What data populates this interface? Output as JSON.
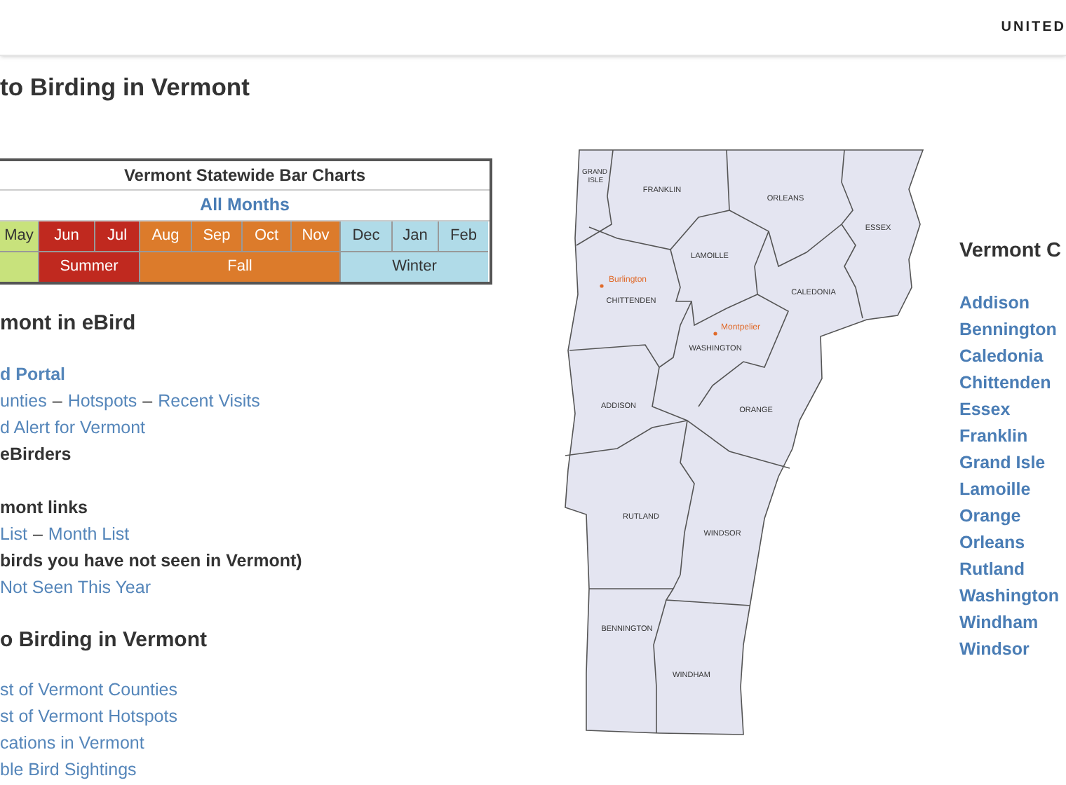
{
  "header": {
    "text": "UNITED"
  },
  "title": "to Birding in Vermont",
  "bar_chart_table": {
    "title": "Vermont Statewide Bar Charts",
    "all_months": "All Months",
    "months": [
      {
        "label": "May",
        "kind": "spring"
      },
      {
        "label": "Jun",
        "kind": "summer"
      },
      {
        "label": "Jul",
        "kind": "summer"
      },
      {
        "label": "Aug",
        "kind": "fall"
      },
      {
        "label": "Sep",
        "kind": "fall"
      },
      {
        "label": "Oct",
        "kind": "fall"
      },
      {
        "label": "Nov",
        "kind": "fall"
      },
      {
        "label": "Dec",
        "kind": "winter"
      },
      {
        "label": "Jan",
        "kind": "winter"
      },
      {
        "label": "Feb",
        "kind": "winter"
      }
    ],
    "seasons": [
      {
        "kind": "spring"
      },
      {
        "label": "Summer",
        "kind": "summer"
      },
      {
        "label": "Fall",
        "kind": "fall"
      },
      {
        "label": "Winter",
        "kind": "winter"
      }
    ]
  },
  "sections": [
    {
      "heading": "mont in eBird",
      "blocks": [
        [
          {
            "bold": true,
            "parts": [
              {
                "kind": "link",
                "text": "d Portal"
              }
            ]
          },
          {
            "bold": false,
            "parts": [
              {
                "kind": "link",
                "text": "unties"
              },
              {
                "kind": "text",
                "text": "–"
              },
              {
                "kind": "link",
                "text": "Hotspots"
              },
              {
                "kind": "text",
                "text": "–"
              },
              {
                "kind": "link",
                "text": "Recent Visits"
              }
            ]
          },
          {
            "bold": false,
            "parts": [
              {
                "kind": "link",
                "text": "d Alert for Vermont"
              }
            ]
          },
          {
            "bold": true,
            "parts": [
              {
                "kind": "text",
                "text": "eBirders"
              }
            ]
          }
        ],
        [
          {
            "bold": true,
            "parts": [
              {
                "kind": "text",
                "text": "mont links"
              }
            ]
          },
          {
            "bold": false,
            "parts": [
              {
                "kind": "link",
                "text": "List"
              },
              {
                "kind": "text",
                "text": "–"
              },
              {
                "kind": "link",
                "text": "Month List"
              }
            ]
          },
          {
            "bold": true,
            "parts": [
              {
                "kind": "text",
                "text": "birds you have not seen in Vermont)"
              }
            ]
          },
          {
            "bold": false,
            "parts": [
              {
                "kind": "link",
                "text": "Not Seen This Year"
              }
            ]
          }
        ]
      ]
    },
    {
      "heading": "o Birding in Vermont",
      "blocks": [
        [
          {
            "bold": false,
            "parts": [
              {
                "kind": "link",
                "text": "st of Vermont Counties"
              }
            ]
          },
          {
            "bold": false,
            "parts": [
              {
                "kind": "link",
                "text": "st of Vermont Hotspots"
              }
            ]
          },
          {
            "bold": false,
            "parts": [
              {
                "kind": "link",
                "text": "cations in Vermont"
              }
            ]
          },
          {
            "bold": false,
            "parts": [
              {
                "kind": "link",
                "text": "ble Bird Sightings"
              }
            ]
          }
        ]
      ]
    }
  ],
  "map": {
    "labels": [
      {
        "kind": "county",
        "text": "GRAND ISLE"
      },
      {
        "kind": "county",
        "text": "FRANKLIN"
      },
      {
        "kind": "county",
        "text": "ORLEANS"
      },
      {
        "kind": "county",
        "text": "ESSEX"
      },
      {
        "kind": "county",
        "text": "LAMOILLE"
      },
      {
        "kind": "city",
        "text": "Burlington"
      },
      {
        "kind": "county",
        "text": "CHITTENDEN"
      },
      {
        "kind": "county",
        "text": "CALEDONIA"
      },
      {
        "kind": "city",
        "text": "Montpelier"
      },
      {
        "kind": "county",
        "text": "WASHINGTON"
      },
      {
        "kind": "county",
        "text": "ADDISON"
      },
      {
        "kind": "county",
        "text": "ORANGE"
      },
      {
        "kind": "county",
        "text": "RUTLAND"
      },
      {
        "kind": "county",
        "text": "WINDSOR"
      },
      {
        "kind": "county",
        "text": "BENNINGTON"
      },
      {
        "kind": "county",
        "text": "WINDHAM"
      }
    ]
  },
  "counties": {
    "heading": "Vermont C",
    "items": [
      "Addison",
      "Bennington",
      "Caledonia",
      "Chittenden",
      "Essex",
      "Franklin",
      "Grand Isle",
      "Lamoille",
      "Orange",
      "Orleans",
      "Rutland",
      "Washington",
      "Windham",
      "Windsor"
    ]
  }
}
